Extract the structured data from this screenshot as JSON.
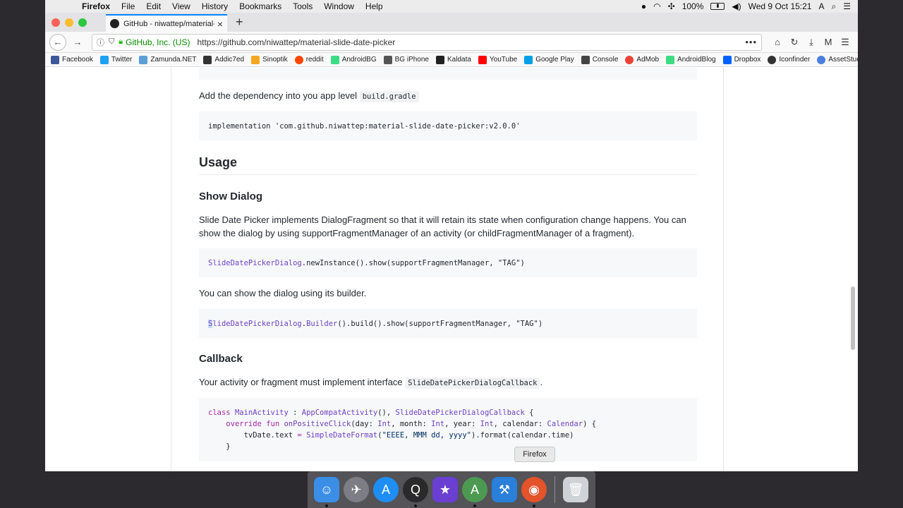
{
  "menubar": {
    "app_name": "Firefox",
    "menus": [
      "File",
      "Edit",
      "View",
      "History",
      "Bookmarks",
      "Tools",
      "Window",
      "Help"
    ],
    "battery": "100%",
    "clock": "Wed 9 Oct  15:21"
  },
  "browser": {
    "tab_title": "GitHub - niwattep/material-slid",
    "org_name": "GitHub, Inc. (US)",
    "url": "https://github.com/niwattep/material-slide-date-picker",
    "bookmarks": [
      {
        "label": "Facebook",
        "color": "#3b5998"
      },
      {
        "label": "Twitter",
        "color": "#1da1f2"
      },
      {
        "label": "Zamunda.NET",
        "color": "#5aa0d8"
      },
      {
        "label": "Addic7ed",
        "color": "#333333"
      },
      {
        "label": "Sinoptik",
        "color": "#f5a623"
      },
      {
        "label": "reddit",
        "color": "#ff4500"
      },
      {
        "label": "AndroidBG",
        "color": "#3ddc84"
      },
      {
        "label": "BG iPhone",
        "color": "#555555"
      },
      {
        "label": "Kaldata",
        "color": "#222222"
      },
      {
        "label": "YouTube",
        "color": "#ff0000"
      },
      {
        "label": "Google Play",
        "color": "#00a0e6"
      },
      {
        "label": "Console",
        "color": "#444444"
      },
      {
        "label": "AdMob",
        "color": "#ea4335"
      },
      {
        "label": "AndroidBlog",
        "color": "#3ddc84"
      },
      {
        "label": "Dropbox",
        "color": "#0061ff"
      },
      {
        "label": "Iconfinder",
        "color": "#333333"
      },
      {
        "label": "AssetStudio",
        "color": "#4a7ee0"
      }
    ]
  },
  "readme": {
    "dependency_text": "Add the dependency into you app level",
    "dependency_code": "build.gradle",
    "implementation_line": "implementation 'com.github.niwattep:material-slide-date-picker:v2.0.0'",
    "usage_heading": "Usage",
    "show_dialog_heading": "Show Dialog",
    "show_dialog_paragraph": "Slide Date Picker implements DialogFragment so that it will retain its state when configuration change happens. You can show the dialog by using supportFragmentManager of an activity (or childFragmentManager of a fragment).",
    "code_newinstance": {
      "cls": "SlideDatePickerDialog",
      "rest": ".newInstance().show(supportFragmentManager, \"TAG\")"
    },
    "builder_text": "You can show the dialog using its builder.",
    "code_builder": {
      "cursor_char": "S",
      "cls": "lideDatePickerDialog",
      "dot": ".",
      "cls2": "Builder",
      "rest": "().build().show(supportFragmentManager, \"TAG\")"
    },
    "callback_heading": "Callback",
    "callback_text": "Your activity or fragment must implement interface",
    "callback_code": "SlideDatePickerDialogCallback",
    "callback_period": ".",
    "code_class": {
      "l1_kw": "class",
      "l1_cls": "MainActivity",
      "l1_sep": " : ",
      "l1_super": "AppCompatActivity",
      "l1_mid": "(), ",
      "l1_iface": "SlideDatePickerDialogCallback",
      "l1_end": " {",
      "l2_kw": "override fun",
      "l2_fn": "onPositiveClick",
      "l2_a": "(day: ",
      "l2_t1": "Int",
      "l2_b": ", month: ",
      "l2_t2": "Int",
      "l2_c": ", year: ",
      "l2_t3": "Int",
      "l2_d": ", calendar: ",
      "l2_t4": "Calendar",
      "l2_e": ") {",
      "l3_a": "tvDate.text ",
      "l3_eq": "=",
      "l3_fn": " SimpleDateFormat",
      "l3_b": "(",
      "l3_str": "\"EEEE, MMM dd, yyyy\"",
      "l3_c": ").format(calendar.time)",
      "l4": "}"
    }
  },
  "tooltip": "Firefox",
  "dock": [
    {
      "name": "finder-icon",
      "color": "#3a8ee6",
      "glyph": "☺"
    },
    {
      "name": "launchpad-icon",
      "color": "#7d7d85",
      "glyph": "✈"
    },
    {
      "name": "app-store-icon",
      "color": "#1e8ef5",
      "glyph": "A"
    },
    {
      "name": "quicktime-icon",
      "color": "#2a2a2a",
      "glyph": "Q"
    },
    {
      "name": "imovie-icon",
      "color": "#6a3fd1",
      "glyph": "★"
    },
    {
      "name": "android-studio-icon",
      "color": "#4c9a52",
      "glyph": "A"
    },
    {
      "name": "xcode-icon",
      "color": "#2a7fd8",
      "glyph": "⚒"
    },
    {
      "name": "firefox-icon",
      "color": "#e4532a",
      "glyph": "◉"
    }
  ]
}
